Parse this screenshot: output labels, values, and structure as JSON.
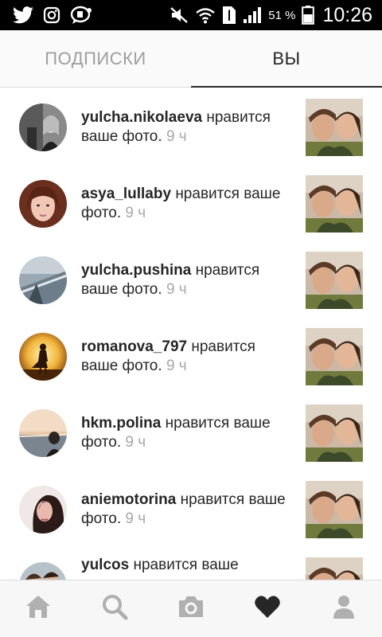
{
  "status_bar": {
    "icons": [
      "twitter-icon",
      "instagram-icon",
      "message-icon",
      "mute-icon",
      "wifi-icon",
      "sim-1-icon",
      "signal-icon",
      "battery-icon"
    ],
    "battery_percent": "51 %",
    "time": "10:26"
  },
  "tabs": [
    {
      "label": "ПОДПИСКИ",
      "active": false
    },
    {
      "label": "ВЫ",
      "active": true
    }
  ],
  "notifications": [
    {
      "username": "yulcha.nikolaeva",
      "action": "нравится ваше фото.",
      "time": "9 ч"
    },
    {
      "username": "asya_lullaby",
      "action": "нравится ваше фото.",
      "time": "9 ч"
    },
    {
      "username": "yulcha.pushina",
      "action": "нравится ваше фото.",
      "time": "9 ч"
    },
    {
      "username": "romanova_797",
      "action": "нравится ваше фото.",
      "time": "9 ч"
    },
    {
      "username": "hkm.polina",
      "action": "нравится ваше фото.",
      "time": "9 ч"
    },
    {
      "username": "aniemotorina",
      "action": "нравится ваше фото.",
      "time": "9 ч"
    },
    {
      "username": "yulcos",
      "action": "нравится ваше",
      "time": ""
    }
  ],
  "bottom_nav": [
    {
      "icon": "home-icon",
      "active": false
    },
    {
      "icon": "search-icon",
      "active": false
    },
    {
      "icon": "camera-icon",
      "active": false
    },
    {
      "icon": "heart-icon",
      "active": true
    },
    {
      "icon": "profile-icon",
      "active": false
    }
  ],
  "colors": {
    "text": "#262626",
    "muted": "#a8a8a8",
    "inactive_icon": "#b0b0b0",
    "tab_inactive": "#9e9e9e"
  }
}
